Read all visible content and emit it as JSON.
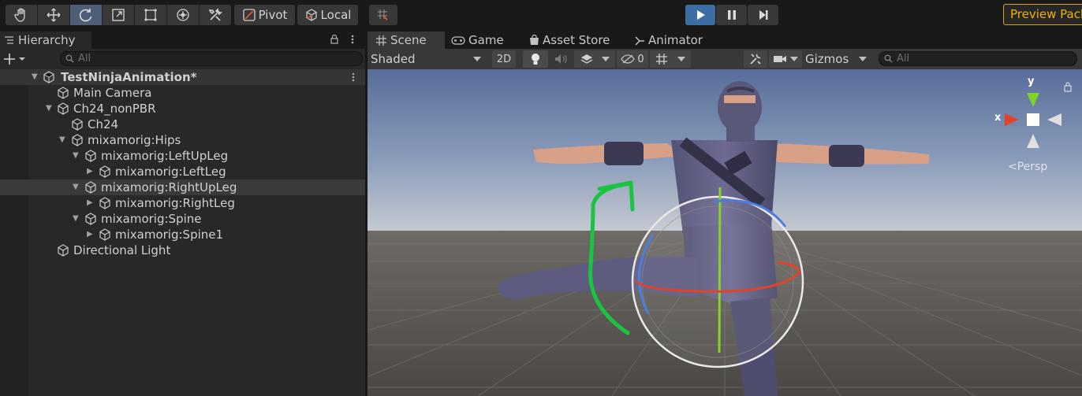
{
  "toolbar": {
    "pivot_label": "Pivot",
    "local_label": "Local",
    "preview_label": "Preview Packages"
  },
  "hierarchy": {
    "tab_label": "Hierarchy",
    "search_placeholder": "All",
    "scene_name": "TestNinjaAnimation*",
    "items": [
      {
        "label": "Main Camera"
      },
      {
        "label": "Ch24_nonPBR"
      },
      {
        "label": "Ch24"
      },
      {
        "label": "mixamorig:Hips"
      },
      {
        "label": "mixamorig:LeftUpLeg"
      },
      {
        "label": "mixamorig:LeftLeg"
      },
      {
        "label": "mixamorig:RightUpLeg"
      },
      {
        "label": "mixamorig:RightLeg"
      },
      {
        "label": "mixamorig:Spine"
      },
      {
        "label": "mixamorig:Spine1"
      },
      {
        "label": "Directional Light"
      }
    ]
  },
  "scene": {
    "tabs": [
      {
        "label": "Scene"
      },
      {
        "label": "Game"
      },
      {
        "label": "Asset Store"
      },
      {
        "label": "Animator"
      }
    ],
    "shading_mode": "Shaded",
    "mode_2d_label": "2D",
    "hidden_count": "0",
    "gizmos_label": "Gizmos",
    "search_placeholder": "All",
    "axis_y": "y",
    "axis_x": "x",
    "projection_label": "Persp"
  },
  "colors": {
    "accent_blue": "#3c6ea3",
    "preview_orange": "#f0b400",
    "annotation_green": "#19c440",
    "gizmo_red": "#e0452b",
    "gizmo_blue": "#4a7ee0",
    "gizmo_green": "#8cd02a"
  }
}
